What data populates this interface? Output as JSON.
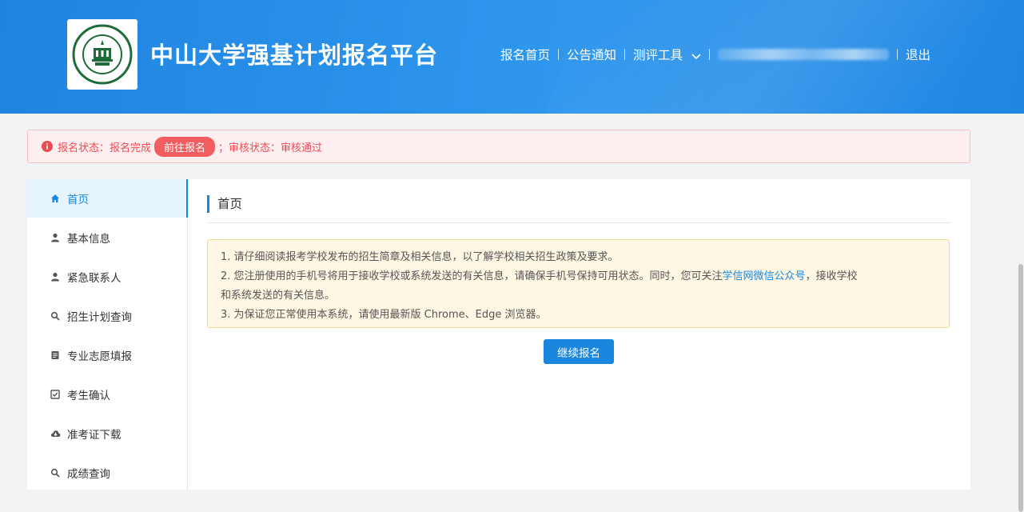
{
  "header": {
    "title": "中山大学强基计划报名平台",
    "logo_text": "中山大学 SUN YAT-SEN UNIVERSITY",
    "nav": {
      "home": "报名首页",
      "notice": "公告通知",
      "tools": "测评工具",
      "logout": "退出"
    }
  },
  "alert": {
    "icon": "info-icon",
    "status_prefix": "报名状态：报名完成",
    "go_button": "前往报名",
    "review_status": "；审核状态：审核通过"
  },
  "sidebar": {
    "items": [
      {
        "label": "首页",
        "icon": "home-icon"
      },
      {
        "label": "基本信息",
        "icon": "user-icon"
      },
      {
        "label": "紧急联系人",
        "icon": "user-icon"
      },
      {
        "label": "招生计划查询",
        "icon": "search-icon"
      },
      {
        "label": "专业志愿填报",
        "icon": "document-icon"
      },
      {
        "label": "考生确认",
        "icon": "checkbox-icon"
      },
      {
        "label": "准考证下载",
        "icon": "cloud-download-icon"
      },
      {
        "label": "成绩查询",
        "icon": "search-icon"
      }
    ]
  },
  "main": {
    "title": "首页",
    "notice": {
      "line1": "1. 请仔细阅读报考学校发布的招生简章及相关信息，以了解学校相关招生政策及要求。",
      "line2_pre": "2. 您注册使用的手机号将用于接收学校或系统发送的有关信息，请确保手机号保持可用状态。同时，您可关注",
      "line2_link": "学信网微信公众号",
      "line2_post": "，接收学校",
      "line3": "和系统发送的有关信息。",
      "line4": "3. 为保证您正常使用本系统，请使用最新版 Chrome、Edge 浏览器。"
    },
    "continue_button": "继续报名"
  },
  "colors": {
    "header_blue": "#2f97ee",
    "accent": "#1a86de",
    "alert_red": "#f04b53",
    "notice_bg": "#fdf7e4"
  }
}
